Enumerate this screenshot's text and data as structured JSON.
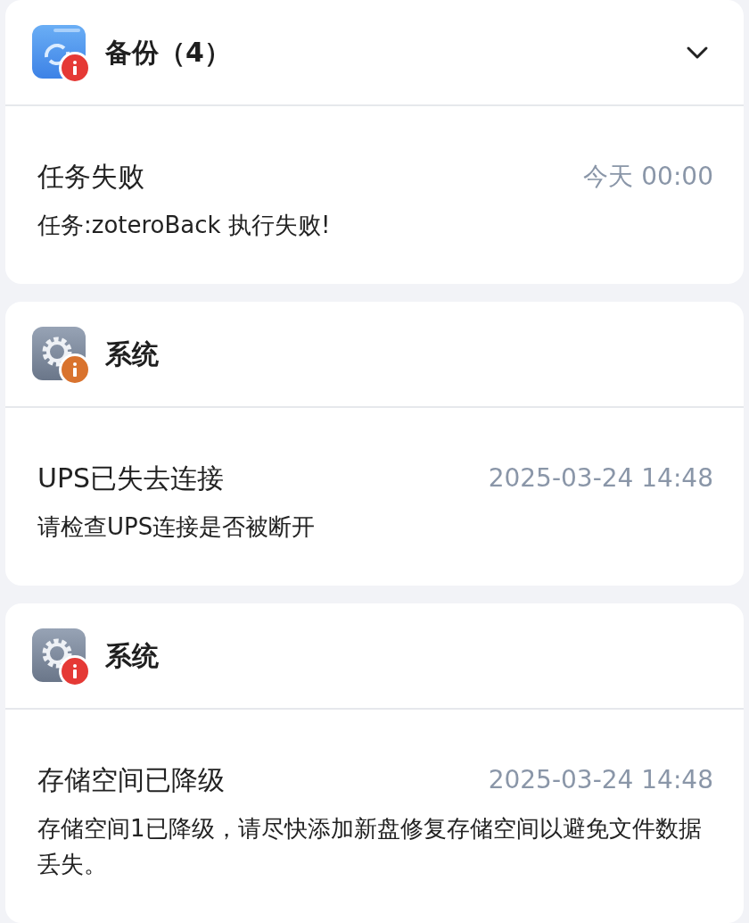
{
  "groups": [
    {
      "title": "备份（4）",
      "kind": "backup",
      "color": "#e53935",
      "collapsible": true,
      "items": [
        {
          "title": "任务失败",
          "time": "今天 00:00",
          "message": "任务:zoteroBack 执行失败!"
        }
      ]
    },
    {
      "title": "系统",
      "kind": "system",
      "color": "#d9732e",
      "collapsible": false,
      "items": [
        {
          "title": "UPS已失去连接",
          "time": "2025-03-24 14:48",
          "message": "请检查UPS连接是否被断开"
        }
      ]
    },
    {
      "title": "系统",
      "kind": "system",
      "color": "#e53935",
      "collapsible": false,
      "items": [
        {
          "title": "存储空间已降级",
          "time": "2025-03-24 14:48",
          "message": "存储空间1已降级，请尽快添加新盘修复存储空间以避免文件数据丢失。"
        }
      ]
    }
  ]
}
